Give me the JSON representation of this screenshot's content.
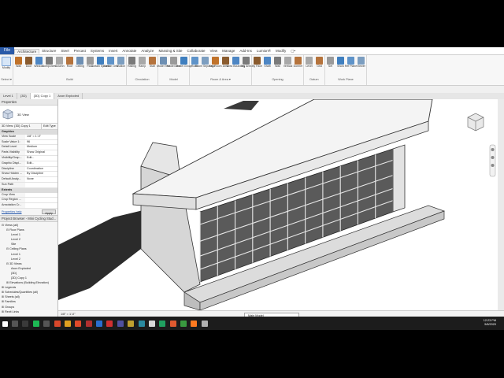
{
  "menubar": {
    "file": "File",
    "items": [
      "Architecture",
      "Structure",
      "Steel",
      "Precast",
      "Systems",
      "Insert",
      "Annotate",
      "Analyze",
      "Massing & Site",
      "Collaborate",
      "View",
      "Manage",
      "Add-Ins",
      "Lumion®",
      "Modify",
      "▢•"
    ],
    "active_index": 0
  },
  "ribbon": {
    "select_label": "Modify",
    "select_group": "Select ▾",
    "groups": [
      {
        "title": "Build",
        "buttons": [
          "Wall",
          "Door",
          "Window",
          "Component",
          "Column",
          "Roof",
          "Ceiling",
          "Floor",
          "Curtain System",
          "Curtain Grid",
          "Mullion"
        ]
      },
      {
        "title": "Circulation",
        "buttons": [
          "Railing",
          "Ramp",
          "Stair"
        ]
      },
      {
        "title": "Model",
        "buttons": [
          "Model Text",
          "Model Line",
          "Model Group"
        ]
      },
      {
        "title": "Room & Area ▾",
        "buttons": [
          "Room",
          "Room Separator",
          "Tag Room",
          "Area",
          "Area Boundary",
          "Tag Area"
        ]
      },
      {
        "title": "Opening",
        "buttons": [
          "By Face",
          "Shaft",
          "Wall",
          "Vertical",
          "Dormer"
        ]
      },
      {
        "title": "Datum",
        "buttons": [
          "Level",
          "Grid"
        ]
      },
      {
        "title": "Work Plane",
        "buttons": [
          "Set",
          "Show",
          "Ref Plane",
          "Viewer"
        ]
      }
    ]
  },
  "doctabs": [
    {
      "label": "Level 1",
      "active": false
    },
    {
      "label": "{3D}",
      "active": false
    },
    {
      "label": "{3D} Copy 1",
      "active": true
    },
    {
      "label": "Axon Exploded",
      "active": false
    }
  ],
  "properties": {
    "title": "Properties",
    "type_name": "3D View",
    "selector": "3D View: {3D} Copy 1",
    "edit_type": "Edit Type",
    "category": "Graphics",
    "rows": [
      {
        "k": "View Scale",
        "v": "1/8\" = 1'-0\""
      },
      {
        "k": "Scale Value 1:",
        "v": "96"
      },
      {
        "k": "Detail Level",
        "v": "Medium"
      },
      {
        "k": "Parts Visibility",
        "v": "Show Original"
      },
      {
        "k": "Visibility/Grap...",
        "v": "Edit..."
      },
      {
        "k": "Graphic Displ...",
        "v": "Edit..."
      },
      {
        "k": "Discipline",
        "v": "Coordination"
      },
      {
        "k": "Show Hidden ...",
        "v": "By Discipline"
      },
      {
        "k": "Default Analy...",
        "v": "None"
      },
      {
        "k": "Sun Path",
        "v": ""
      }
    ],
    "category2": "Extents",
    "rows2": [
      {
        "k": "Crop View",
        "v": ""
      },
      {
        "k": "Crop Region ...",
        "v": ""
      },
      {
        "k": "Annotation Cr...",
        "v": ""
      }
    ],
    "help": "Properties help",
    "apply": "Apply"
  },
  "browser": {
    "title": "Project Browser - Mini Cycling Stud...",
    "items": [
      {
        "t": "⊟ Views (all)",
        "d": 0
      },
      {
        "t": "⊟ Floor Plans",
        "d": 1
      },
      {
        "t": "Level 1",
        "d": 2
      },
      {
        "t": "Level 2",
        "d": 2
      },
      {
        "t": "Site",
        "d": 2
      },
      {
        "t": "⊟ Ceiling Plans",
        "d": 1
      },
      {
        "t": "Level 1",
        "d": 2
      },
      {
        "t": "Level 2",
        "d": 2
      },
      {
        "t": "⊟ 3D Views",
        "d": 1
      },
      {
        "t": "Axon Exploded",
        "d": 2
      },
      {
        "t": "{3D}",
        "d": 2
      },
      {
        "t": "{3D} Copy 1",
        "d": 2
      },
      {
        "t": "⊞ Elevations (Building Elevation)",
        "d": 1
      },
      {
        "t": "⊞ Legends",
        "d": 0
      },
      {
        "t": "⊞ Schedules/Quantities (all)",
        "d": 0
      },
      {
        "t": "⊞ Sheets (all)",
        "d": 0
      },
      {
        "t": "⊞ Families",
        "d": 0
      },
      {
        "t": "⊞ Groups",
        "d": 0
      },
      {
        "t": "⊞ Revit Links",
        "d": 0
      }
    ]
  },
  "viewbar": {
    "scale": "1/8\" = 1'-0\""
  },
  "status": {
    "text": "Ready",
    "model": "Main Model"
  },
  "taskbar": {
    "time": "12:23 PM",
    "date": "5/8/2020"
  },
  "colors": {
    "accent": "#2a5aa8",
    "taskbar": "#1c1c1c"
  }
}
